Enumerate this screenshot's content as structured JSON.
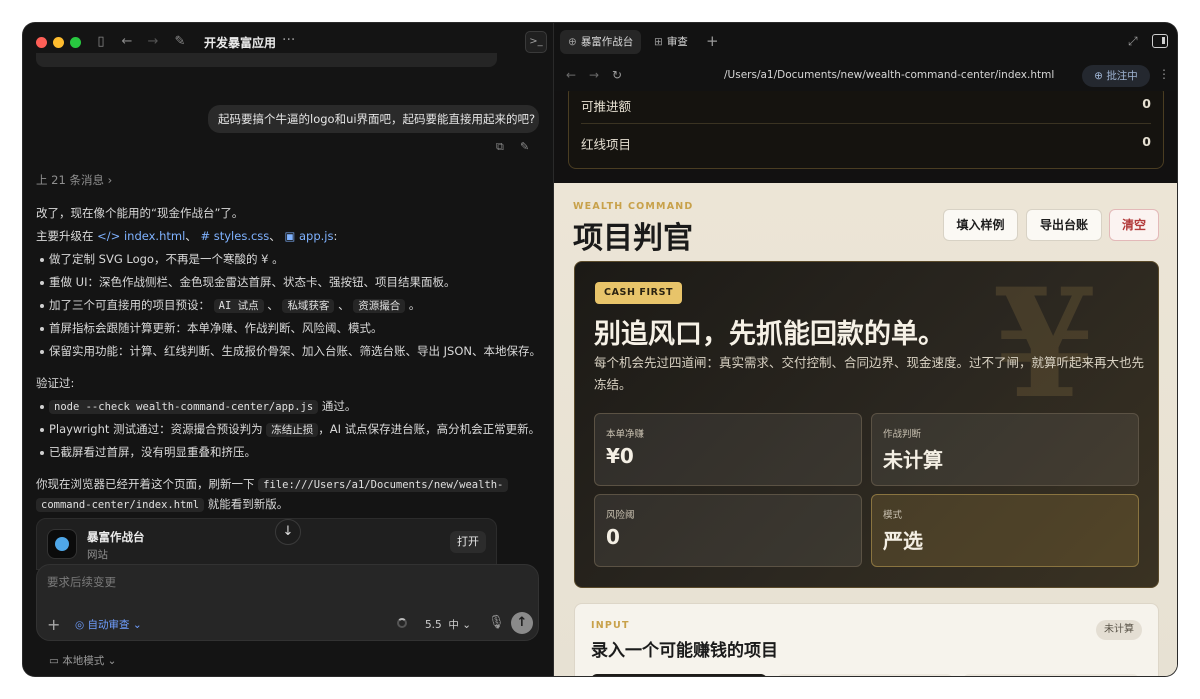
{
  "left": {
    "title": "开发暴富应用",
    "user_message": "起码要搞个牛逼的logo和ui界面吧，起码要能直接用起来的吧?",
    "history_label": "上 21 条消息",
    "reply": {
      "intro": "改了，现在像个能用的“现金作战台”了。",
      "upgrade_prefix": "主要升级在",
      "files": [
        "index.html",
        "styles.css",
        "app.js"
      ],
      "bullets": [
        "做了定制 SVG Logo，不再是一个寒酸的 ¥ 。",
        "重做 UI：深色作战侧栏、金色现金雷达首屏、状态卡、强按钮、项目结果面板。",
        "加了三个可直接用的项目预设：",
        "首屏指标会跟随计算更新：本单净赚、作战判断、风险阈、模式。",
        "保留实用功能：计算、红线判断、生成报价骨架、加入台账、筛选台账、导出 JSON、本地保存。"
      ],
      "presets": [
        "AI 试点",
        "私域获客",
        "资源撮合"
      ],
      "verified_label": "验证过:",
      "verify_cmd": "node --check wealth-command-center/app.js",
      "verify_cmd_suffix": "通过。",
      "verify_pw_prefix": "Playwright 测试通过：资源撮合预设判为",
      "verify_pw_code": "冻结止损",
      "verify_pw_suffix": "，AI 试点保存进台账，高分机会正常更新。",
      "verify_screenshot": "已截屏看过首屏，没有明显重叠和挤压。",
      "closing_prefix": "你现在浏览器已经开着这个页面，刷新一下",
      "closing_path_1": "file:///Users/a1/Documents/new/wealth-",
      "closing_path_2": "command-center/index.html",
      "closing_suffix": "就能看到新版。"
    },
    "site_card": {
      "title": "暴富作战台",
      "subtitle": "网站",
      "open_label": "打开"
    },
    "composer": {
      "placeholder": "要求后续变更",
      "auto_review": "自动审查",
      "model": "5.5",
      "effort": "中"
    },
    "local_mode": "本地模式"
  },
  "right": {
    "tabs": [
      {
        "label": "暴富作战台",
        "icon": "globe-icon"
      },
      {
        "label": "审查",
        "icon": "diff-icon"
      }
    ],
    "url": "/Users/a1/Documents/new/wealth-command-center/index.html",
    "approve_label": "批注中",
    "page": {
      "metric_rows": [
        {
          "label": "可推进额",
          "value": "0"
        },
        {
          "label": "红线项目",
          "value": "0"
        }
      ],
      "eyebrow": "WEALTH COMMAND",
      "title": "项目判官",
      "buttons": {
        "sample": "填入样例",
        "export": "导出台账",
        "clear": "清空"
      },
      "hero": {
        "badge": "CASH FIRST",
        "headline": "别追风口，先抓能回款的单。",
        "description": "每个机会先过四道闸：真实需求、交付控制、合同边界、现金速度。过不了闸，就算听起来再大也先冻结。",
        "watermark": "¥",
        "stats": [
          {
            "label": "本单净赚",
            "value": "¥0"
          },
          {
            "label": "作战判断",
            "value": "未计算"
          },
          {
            "label": "风险阈",
            "value": "0"
          },
          {
            "label": "模式",
            "value": "严选"
          }
        ]
      },
      "input_card": {
        "eyebrow": "INPUT",
        "title": "录入一个可能赚钱的项目",
        "badge": "未计算"
      }
    }
  },
  "colors": {
    "accent_gold": "#c8a14a",
    "badge_gold": "#e8c46a",
    "link_blue": "#7fb2ff",
    "danger_red": "#b23a3a"
  }
}
